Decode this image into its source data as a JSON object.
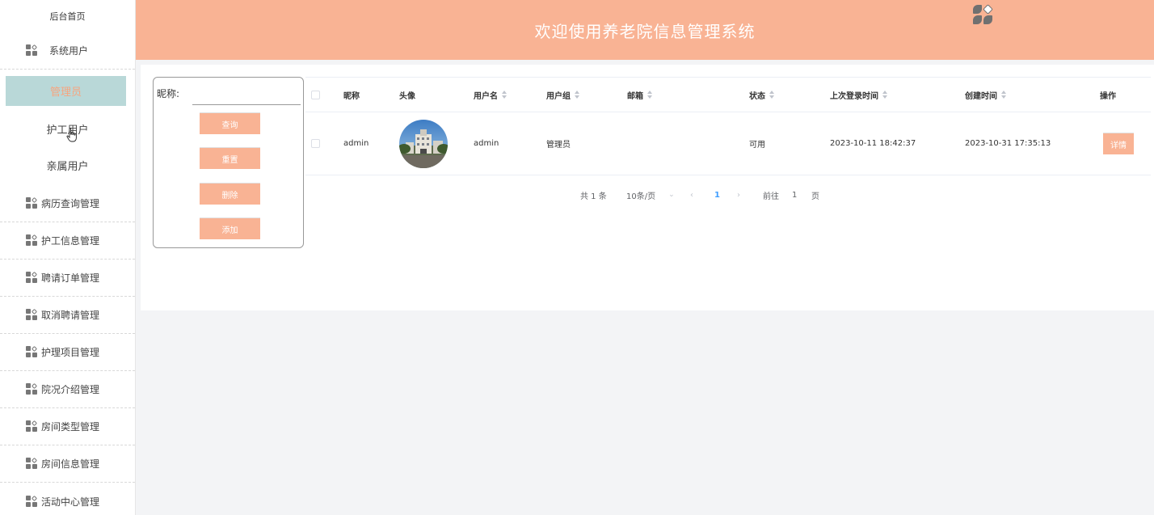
{
  "sidebar": {
    "home": "后台首页",
    "group_title": "系统用户",
    "sub_items": [
      "管理员",
      "护工用户",
      "亲属用户"
    ],
    "menu_items": [
      "病历查询管理",
      "护工信息管理",
      "聘请订单管理",
      "取消聘请管理",
      "护理项目管理",
      "院况介绍管理",
      "房间类型管理",
      "房间信息管理",
      "活动中心管理"
    ]
  },
  "header": {
    "title": "欢迎使用养老院信息管理系统"
  },
  "search": {
    "label": "昵称:",
    "value": "",
    "buttons": {
      "query": "查询",
      "reset": "重置",
      "delete": "删除",
      "add": "添加"
    }
  },
  "table": {
    "headers": {
      "nickname": "昵称",
      "avatar": "头像",
      "username": "用户名",
      "group": "用户组",
      "email": "邮箱",
      "status": "状态",
      "last_login": "上次登录时间",
      "created": "创建时间",
      "action": "操作"
    },
    "rows": [
      {
        "nickname": "admin",
        "username": "admin",
        "group": "管理员",
        "email": "",
        "status": "可用",
        "last_login": "2023-10-11 18:42:37",
        "created": "2023-10-31 17:35:13",
        "action": "详情"
      }
    ]
  },
  "pagination": {
    "total": "共 1 条",
    "page_size": "10条/页",
    "current_page": "1",
    "goto_label": "前往",
    "goto_value": "1",
    "page_suffix": "页"
  },
  "colors": {
    "accent": "#f9b394",
    "active_bg": "#b9d8d8",
    "active_text": "#f7a57f"
  }
}
